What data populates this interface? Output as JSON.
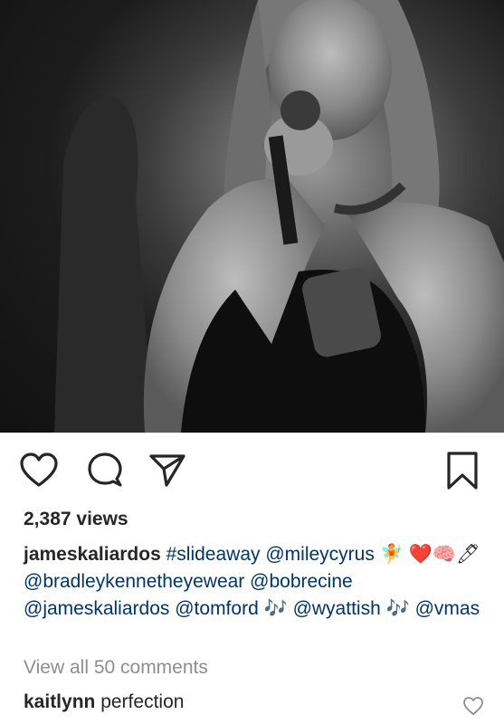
{
  "post": {
    "views": "2,387 views",
    "caption": {
      "username": "jameskaliardos",
      "parts": [
        {
          "text": "#slideaway",
          "type": "tag"
        },
        {
          "text": " ",
          "type": "text"
        },
        {
          "text": "@mileycyrus",
          "type": "tag"
        },
        {
          "text": " 🧚 ",
          "type": "text"
        },
        {
          "text": "❤️🧠🖊 ",
          "type": "text"
        },
        {
          "text": "@bradleykennetheyewear",
          "type": "tag"
        },
        {
          "text": " ",
          "type": "text"
        },
        {
          "text": "@bobrecine",
          "type": "tag"
        },
        {
          "text": " ",
          "type": "text"
        },
        {
          "text": "@jameskaliardos",
          "type": "tag"
        },
        {
          "text": " ",
          "type": "text"
        },
        {
          "text": "@tomford",
          "type": "tag"
        },
        {
          "text": " 🎶 ",
          "type": "text"
        },
        {
          "text": "@wyattish",
          "type": "tag"
        },
        {
          "text": " 🎶 ",
          "type": "text"
        },
        {
          "text": "@vmas",
          "type": "tag"
        }
      ]
    },
    "view_all_comments": "View all 50 comments",
    "comment": {
      "username": "kaitlynn",
      "text": "perfection"
    }
  },
  "icons": {
    "like": "heart-outline-icon",
    "comment": "speech-bubble-icon",
    "share": "paper-plane-icon",
    "save": "bookmark-outline-icon",
    "comment_like": "small-heart-icon"
  },
  "colors": {
    "text": "#262626",
    "link": "#003569",
    "muted": "#8e8e8e"
  }
}
